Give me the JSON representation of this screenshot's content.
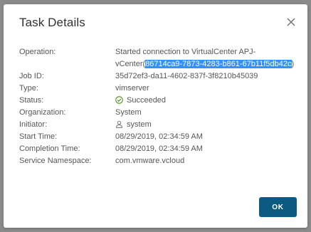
{
  "dialog": {
    "title": "Task Details",
    "ok_label": "OK"
  },
  "details": {
    "operation": {
      "label": "Operation:",
      "value_line1": "Started connection to VirtualCenter APJ-",
      "value_line2_prefix": "vCenter(",
      "value_line2_selected": "86714ca9-7873-4283-b861-67b11f5db42c",
      "value_line2_suffix": ")"
    },
    "job_id": {
      "label": "Job ID:",
      "value": "35d72ef3-da11-4602-837f-3f8210b45039"
    },
    "type": {
      "label": "Type:",
      "value": "vimserver"
    },
    "status": {
      "label": "Status:",
      "value": "Succeeded",
      "icon": "check-circle-icon",
      "icon_color": "#2f8400"
    },
    "organization": {
      "label": "Organization:",
      "value": "System"
    },
    "initiator": {
      "label": "Initiator:",
      "value": "system",
      "icon": "user-icon"
    },
    "start_time": {
      "label": "Start Time:",
      "value": "08/29/2019, 02:34:59 AM"
    },
    "completion_time": {
      "label": "Completion Time:",
      "value": "08/29/2019, 02:34:59 AM"
    },
    "service_namespace": {
      "label": "Service Namespace:",
      "value": "com.vmware.vcloud"
    }
  },
  "colors": {
    "primary_button": "#0a5a82",
    "selection": "#3390ff",
    "backdrop": "#8b8b8b"
  }
}
